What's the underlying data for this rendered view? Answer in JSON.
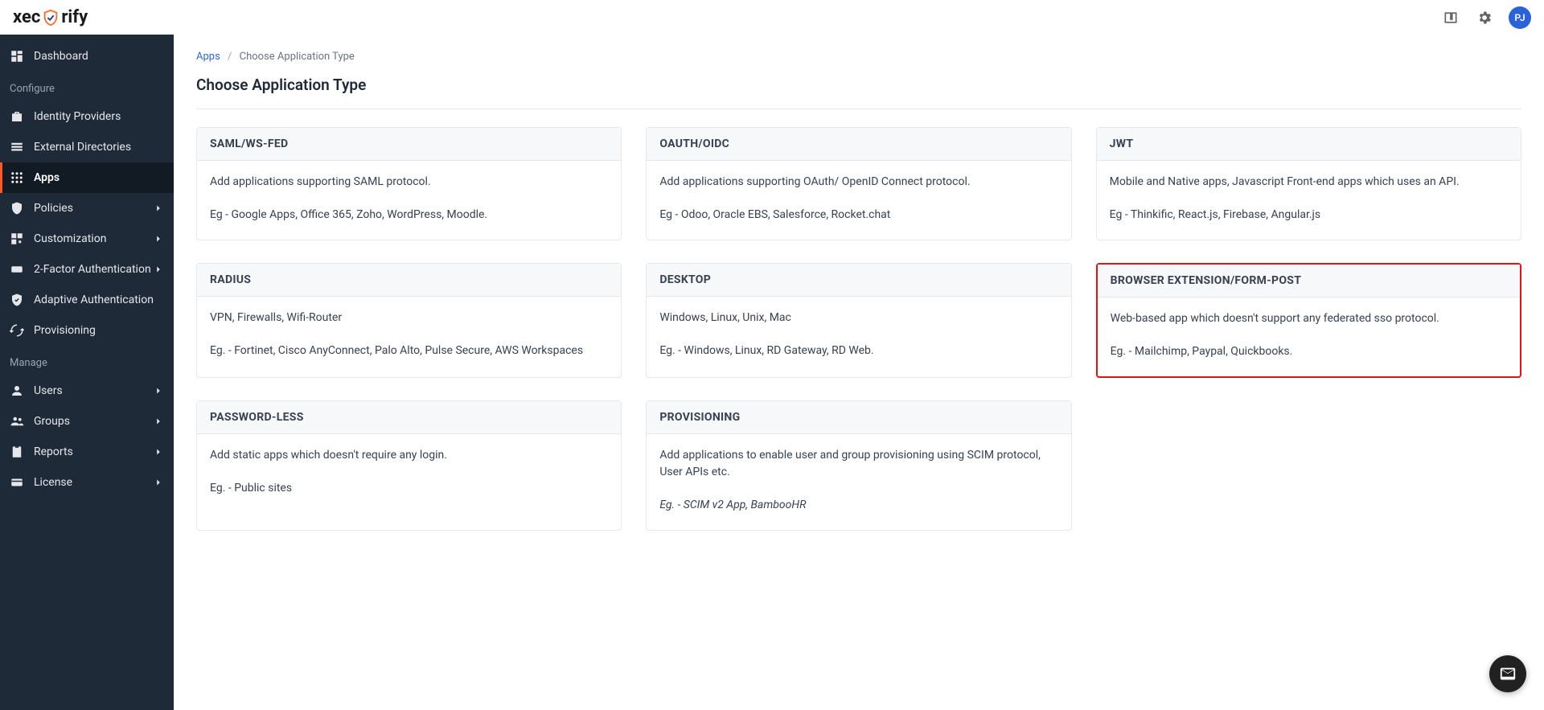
{
  "brand": {
    "name_left": "xec",
    "name_right": "rify"
  },
  "avatar": {
    "initials": "PJ"
  },
  "breadcrumb": {
    "link": "Apps",
    "current": "Choose Application Type"
  },
  "page": {
    "title": "Choose Application Type"
  },
  "sidebar": {
    "section_configure": "Configure",
    "section_manage": "Manage",
    "items": {
      "dashboard": "Dashboard",
      "idp": "Identity Providers",
      "ext_dir": "External Directories",
      "apps": "Apps",
      "policies": "Policies",
      "customization": "Customization",
      "twofa": "2-Factor Authentication",
      "adaptive": "Adaptive Authentication",
      "provisioning": "Provisioning",
      "users": "Users",
      "groups": "Groups",
      "reports": "Reports",
      "license": "License"
    }
  },
  "cards": {
    "saml": {
      "title": "SAML/WS-FED",
      "desc": "Add applications supporting SAML protocol.",
      "eg": "Eg - Google Apps, Office 365, Zoho, WordPress, Moodle."
    },
    "oauth": {
      "title": "OAUTH/OIDC",
      "desc": "Add applications supporting OAuth/ OpenID Connect protocol.",
      "eg": "Eg - Odoo, Oracle EBS, Salesforce, Rocket.chat"
    },
    "jwt": {
      "title": "JWT",
      "desc": "Mobile and Native apps, Javascript Front-end apps which uses an API.",
      "eg": "Eg - Thinkific, React.js, Firebase, Angular.js"
    },
    "radius": {
      "title": "RADIUS",
      "desc": "VPN, Firewalls, Wifi-Router",
      "eg": "Eg. - Fortinet, Cisco AnyConnect, Palo Alto, Pulse Secure, AWS Workspaces"
    },
    "desktop": {
      "title": "DESKTOP",
      "desc": "Windows, Linux, Unix, Mac",
      "eg": "Eg. - Windows, Linux, RD Gateway, RD Web."
    },
    "browser_ext": {
      "title": "BROWSER EXTENSION/FORM-POST",
      "desc": "Web-based app which doesn't support any federated sso protocol.",
      "eg": "Eg. - Mailchimp, Paypal, Quickbooks."
    },
    "passwordless": {
      "title": "PASSWORD-LESS",
      "desc": "Add static apps which doesn't require any login.",
      "eg": "Eg. - Public sites"
    },
    "prov": {
      "title": "PROVISIONING",
      "desc": "Add applications to enable user and group provisioning using SCIM protocol, User APIs etc.",
      "eg": "Eg. - SCIM v2 App, BambooHR"
    }
  }
}
